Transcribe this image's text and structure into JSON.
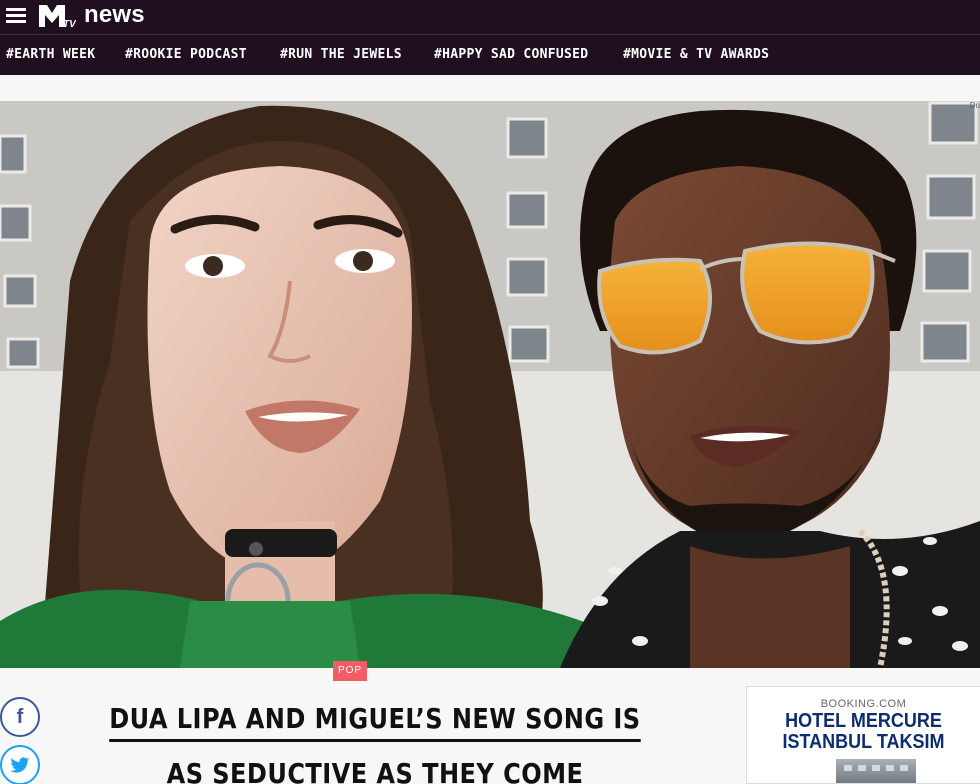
{
  "header": {
    "brand_news": "news",
    "logo_text": "M TV"
  },
  "tags": [
    {
      "label": "#EARTH WEEK"
    },
    {
      "label": "#ROOKIE PODCAST"
    },
    {
      "label": "#RUN THE JEWELS"
    },
    {
      "label": "#HAPPY SAD CONFUSED"
    },
    {
      "label": "#MOVIE & TV AWARDS"
    }
  ],
  "hero": {
    "credit": "Du"
  },
  "article": {
    "category": "POP",
    "headline_line1": "DUA LIPA AND MIGUEL’S NEW SONG IS",
    "headline_line2": "AS SEDUCTIVE AS THEY COME"
  },
  "social": {
    "facebook_glyph": "f",
    "twitter_glyph": "🐦"
  },
  "ad": {
    "source": "BOOKING.COM",
    "title_line1": "HOTEL MERCURE",
    "title_line2": "ISTANBUL TAKSIM"
  },
  "colors": {
    "header_bg": "#1f0f1f",
    "category_tag": "#f25c64",
    "facebook": "#3b5998",
    "twitter": "#1da1f2",
    "ad_title": "#0c2d6e"
  }
}
